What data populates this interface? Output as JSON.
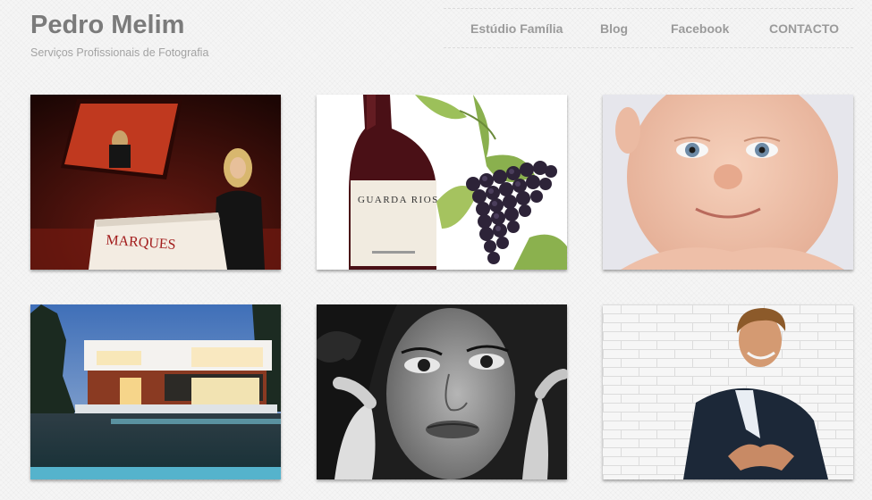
{
  "header": {
    "title": "Pedro Melim",
    "tagline": "Serviços Profissionais de Fotografia"
  },
  "nav": {
    "items": [
      {
        "label": "Estúdio Família"
      },
      {
        "label": "Blog"
      },
      {
        "label": "Facebook"
      },
      {
        "label": "CONTACTO"
      }
    ]
  },
  "gallery": {
    "photos": [
      {
        "subject": "conference-speaker",
        "podium_text": "MARQUES"
      },
      {
        "subject": "wine-bottle",
        "label_text": "GUARDA RIOS"
      },
      {
        "subject": "baby-face"
      },
      {
        "subject": "modern-house-pool"
      },
      {
        "subject": "woman-portrait"
      },
      {
        "subject": "businessman-portrait"
      }
    ]
  }
}
